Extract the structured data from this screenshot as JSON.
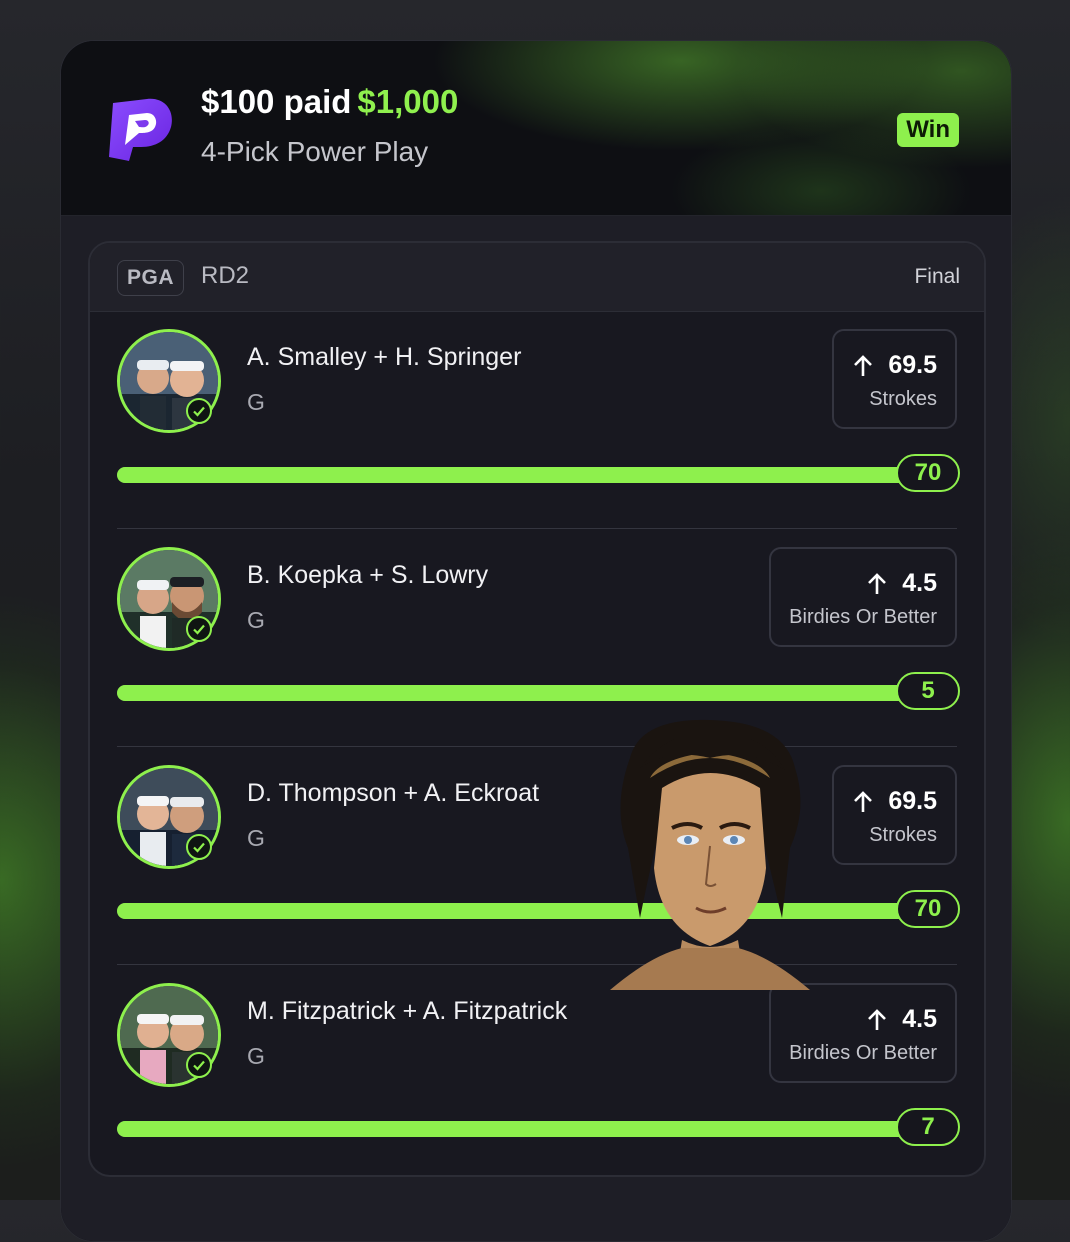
{
  "header": {
    "entry": "$100 paid",
    "payout": "$1,000",
    "subtitle": "4-Pick Power Play",
    "status": "Win"
  },
  "panel": {
    "league": "PGA",
    "round": "RD2",
    "state": "Final"
  },
  "picks": [
    {
      "players": "A. Smalley + H. Springer",
      "sport": "G",
      "direction_icon": "arrow-up-icon",
      "line": "69.5",
      "stat": "Strokes",
      "result": "70",
      "progress": 1.0
    },
    {
      "players": "B. Koepka + S. Lowry",
      "sport": "G",
      "direction_icon": "arrow-up-icon",
      "line": "4.5",
      "stat": "Birdies Or Better",
      "result": "5",
      "progress": 1.0
    },
    {
      "players": "D. Thompson + A. Eckroat",
      "sport": "G",
      "direction_icon": "arrow-up-icon",
      "line": "69.5",
      "stat": "Strokes",
      "result": "70",
      "progress": 1.0
    },
    {
      "players": "M. Fitzpatrick + A. Fitzpatrick",
      "sport": "G",
      "direction_icon": "arrow-up-icon",
      "line": "4.5",
      "stat": "Birdies Or Better",
      "result": "7",
      "progress": 1.0
    }
  ],
  "colors": {
    "accent": "#8ef04d",
    "brand": "#7c3aed",
    "card": "#121218"
  }
}
